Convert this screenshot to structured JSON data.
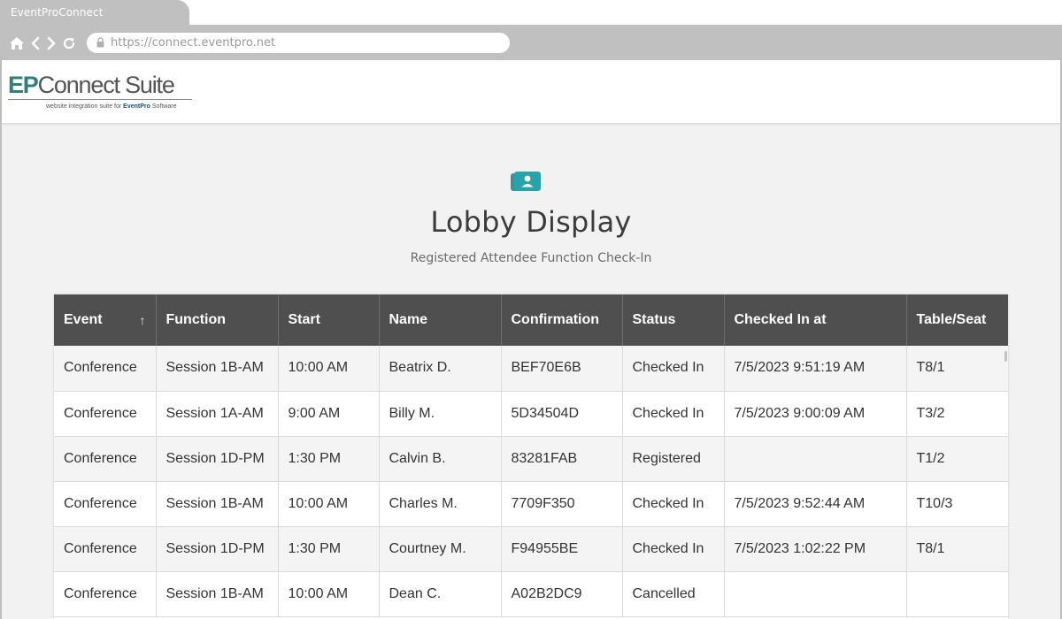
{
  "browser": {
    "tab_title": "EventProConnect",
    "url": "https://connect.eventpro.net"
  },
  "brand": {
    "logo_ep": "EP",
    "logo_connect_suite": "Connect Suite",
    "logo_tagline": "website integration suite for",
    "logo_tagline_brand": "EventPro",
    "logo_tagline_suffix": "Software",
    "colors": {
      "teal": "#2f7f7a",
      "green": "#6ea94a",
      "icon": "#2a9aa0"
    }
  },
  "page": {
    "icon": "attendee-badge-icon",
    "title": "Lobby Display",
    "subtitle": "Registered Attendee Function Check-In"
  },
  "table": {
    "headers": [
      "Event",
      "Function",
      "Start",
      "Name",
      "Confirmation",
      "Status",
      "Checked In at",
      "Table/Seat"
    ],
    "sort_indicator": "↑",
    "rows": [
      [
        "Conference",
        "Session 1B-AM",
        "10:00 AM",
        "Beatrix D.",
        "BEF70E6B",
        "Checked In",
        "7/5/2023  9:51:19 AM",
        "T8/1"
      ],
      [
        "Conference",
        "Session 1A-AM",
        "9:00 AM",
        "Billy M.",
        "5D34504D",
        "Checked In",
        "7/5/2023  9:00:09 AM",
        "T3/2"
      ],
      [
        "Conference",
        "Session 1D-PM",
        "1:30 PM",
        "Calvin B.",
        "83281FAB",
        "Registered",
        "",
        "T1/2"
      ],
      [
        "Conference",
        "Session 1B-AM",
        "10:00 AM",
        "Charles M.",
        "7709F350",
        "Checked In",
        "7/5/2023  9:52:44 AM",
        "T10/3"
      ],
      [
        "Conference",
        "Session 1D-PM",
        "1:30 PM",
        "Courtney M.",
        "F94955BE",
        "Checked In",
        "7/5/2023  1:02:22 PM",
        "T8/1"
      ],
      [
        "Conference",
        "Session 1B-AM",
        "10:00 AM",
        "Dean C.",
        "A02B2DC9",
        "Cancelled",
        "",
        ""
      ]
    ]
  }
}
